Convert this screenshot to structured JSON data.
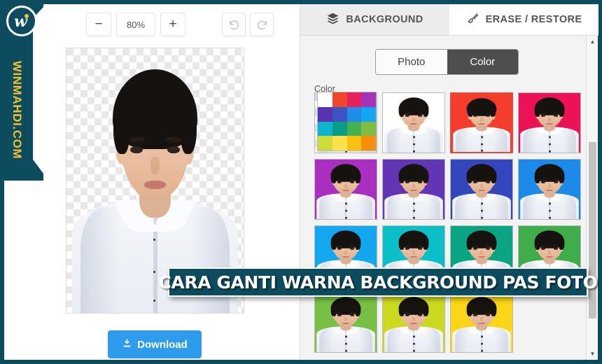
{
  "brand": {
    "logo_letter": "w",
    "site": "WINMAHDI.COM"
  },
  "banner": {
    "text": "CARA GANTI WARNA BACKGROUND PAS FOTO"
  },
  "toolbar": {
    "zoom_out_label": "−",
    "zoom_level": "80%",
    "zoom_in_label": "+",
    "undo_name": "undo",
    "redo_name": "redo"
  },
  "editor": {
    "download_label": "Download",
    "download_color": "#2f9ceb",
    "canvas_background": "transparent-checkerboard"
  },
  "panel": {
    "tabs": [
      {
        "label": "BACKGROUND",
        "icon": "layers-icon",
        "active": true
      },
      {
        "label": "ERASE / RESTORE",
        "icon": "brush-icon",
        "active": false
      }
    ],
    "mode_toggle": {
      "options": [
        {
          "label": "Photo",
          "selected": false
        },
        {
          "label": "Color",
          "selected": true
        }
      ]
    },
    "color_label": "Color",
    "palette": [
      "#ffffff",
      "#f0462b",
      "#e8205e",
      "#a533b8",
      "#5a34b0",
      "#3a54c0",
      "#1f8de8",
      "#14a6ef",
      "#0fb5cf",
      "#0c9b84",
      "#45b052",
      "#7fbc42",
      "#cddc39",
      "#fbe14b",
      "#fcc00f",
      "#f79009"
    ],
    "thumbnails": [
      {
        "name": "transparent",
        "color": "transparent",
        "selected": false
      },
      {
        "name": "white",
        "color": "#ffffff",
        "selected": false
      },
      {
        "name": "red",
        "color": "#f53d2d",
        "selected": true
      },
      {
        "name": "crimson",
        "color": "#ec1256",
        "selected": false
      },
      {
        "name": "magenta",
        "color": "#a82fc0",
        "selected": false
      },
      {
        "name": "purple",
        "color": "#6235b5",
        "selected": false
      },
      {
        "name": "royal-blue",
        "color": "#3446bd",
        "selected": false
      },
      {
        "name": "blue",
        "color": "#1b8ae8",
        "selected": false
      },
      {
        "name": "light-blue",
        "color": "#12a7ef",
        "selected": false
      },
      {
        "name": "cyan",
        "color": "#0bbfc9",
        "selected": false
      },
      {
        "name": "teal",
        "color": "#09a583",
        "selected": false
      },
      {
        "name": "green",
        "color": "#3fae4a",
        "selected": false
      },
      {
        "name": "light-green",
        "color": "#76c044",
        "selected": false
      },
      {
        "name": "yellow-green",
        "color": "#cbd91f",
        "selected": false
      },
      {
        "name": "yellow",
        "color": "#fbd617",
        "selected": false
      }
    ],
    "scrollbar": {
      "up_arrow": "▲",
      "down_arrow": "▼"
    }
  }
}
